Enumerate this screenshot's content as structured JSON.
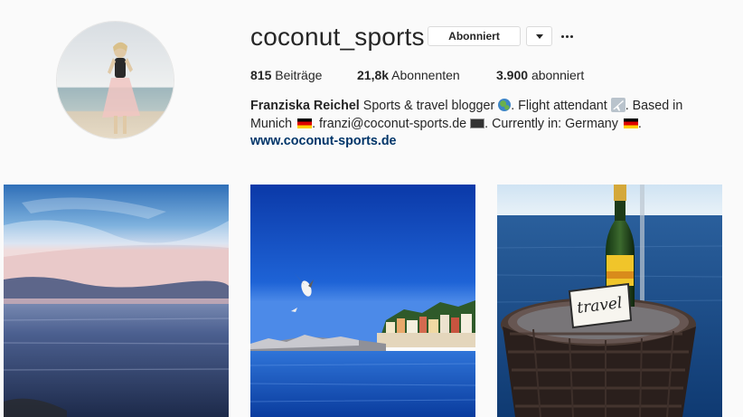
{
  "profile": {
    "username": "coconut_sports",
    "follow_label": "Abonniert",
    "stats": [
      {
        "value": "815",
        "label": "Beiträge"
      },
      {
        "value": "21,8k",
        "label": "Abonnenten"
      },
      {
        "value": "3.900",
        "label": "abonniert"
      }
    ],
    "bio": {
      "name": "Franziska Reichel",
      "part1": "Sports & travel blogger",
      "part2": ". Flight attendant",
      "part3": ". Based in Munich",
      "part4": ". franzi@coconut-sports.de",
      "part5": ". Currently in: Germany",
      "part6": "."
    },
    "website": "www.coconut-sports.de"
  },
  "icons": {
    "dropdown": "chevron-down-icon",
    "more": "ellipsis-icon",
    "globe": "globe-icon",
    "plane": "airplane-icon",
    "flag": "germany-flag-icon",
    "monitor": "desktop-icon"
  },
  "posts": {
    "tile3_card_text": "travel"
  },
  "colors": {
    "link": "#003569",
    "text": "#262626",
    "background": "#fafafa"
  }
}
